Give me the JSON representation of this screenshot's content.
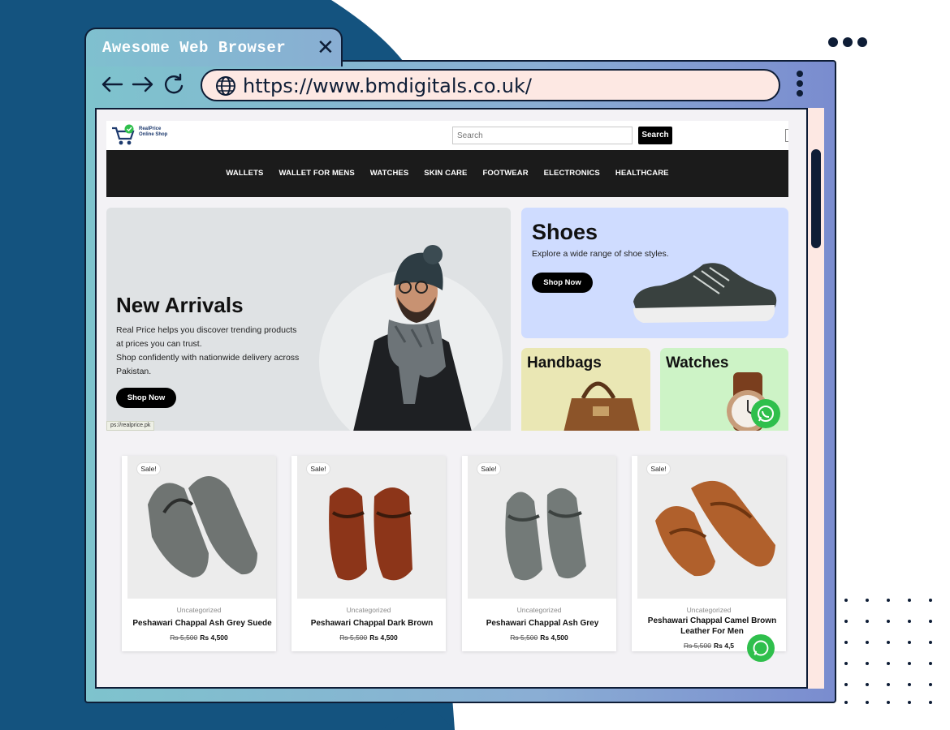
{
  "colors": {
    "navy": "#0e1d36",
    "accent_blue": "#14537f",
    "url_bg": "#fde8e3",
    "whatsapp": "#2fbf4c"
  },
  "browser": {
    "tab_title": "Awesome Web Browser",
    "close_icon": "close-icon",
    "url": "https://www.bmdigitals.co.uk/",
    "icons": [
      "back-arrow-icon",
      "forward-arrow-icon",
      "reload-icon",
      "globe-icon",
      "kebab-menu-icon",
      "three-dots-icon"
    ]
  },
  "site": {
    "logo_line1": "RealPrice",
    "logo_line2": "Online Shop",
    "search_placeholder": "Search",
    "search_button": "Search",
    "menu": [
      "WALLETS",
      "WALLET FOR MENS",
      "WATCHES",
      "SKIN CARE",
      "FOOTWEAR",
      "ELECTRONICS",
      "HEALTHCARE"
    ],
    "hero": {
      "title": "New Arrivals",
      "line1": "Real Price helps you discover trending products",
      "line2": "at prices you can trust.",
      "line3": "Shop confidently with nationwide delivery across",
      "line4": "Pakistan.",
      "button": "Shop Now"
    },
    "status_url": "ps://realprice.pk",
    "shoes": {
      "title": "Shoes",
      "subtitle": "Explore a wide range of shoe styles.",
      "button": "Shop Now"
    },
    "handbags": {
      "title": "Handbags"
    },
    "watches": {
      "title": "Watches"
    },
    "products": [
      {
        "badge": "Sale!",
        "category": "Uncategorized",
        "name": "Peshawari Chappal Ash Grey Suede",
        "old_price": "Rs 5,500",
        "price": "Rs 4,500",
        "color": "#6f7472"
      },
      {
        "badge": "Sale!",
        "category": "Uncategorized",
        "name": "Peshawari Chappal Dark Brown",
        "old_price": "Rs 5,500",
        "price": "Rs 4,500",
        "color": "#8c3519"
      },
      {
        "badge": "Sale!",
        "category": "Uncategorized",
        "name": "Peshawari Chappal Ash Grey",
        "old_price": "Rs 5,500",
        "price": "Rs 4,500",
        "color": "#737a78"
      },
      {
        "badge": "Sale!",
        "category": "Uncategorized",
        "name": "Peshawari Chappal Camel Brown Leather For Men",
        "old_price": "Rs 5,500",
        "price": "Rs 4,5",
        "color": "#b0602c"
      }
    ]
  }
}
